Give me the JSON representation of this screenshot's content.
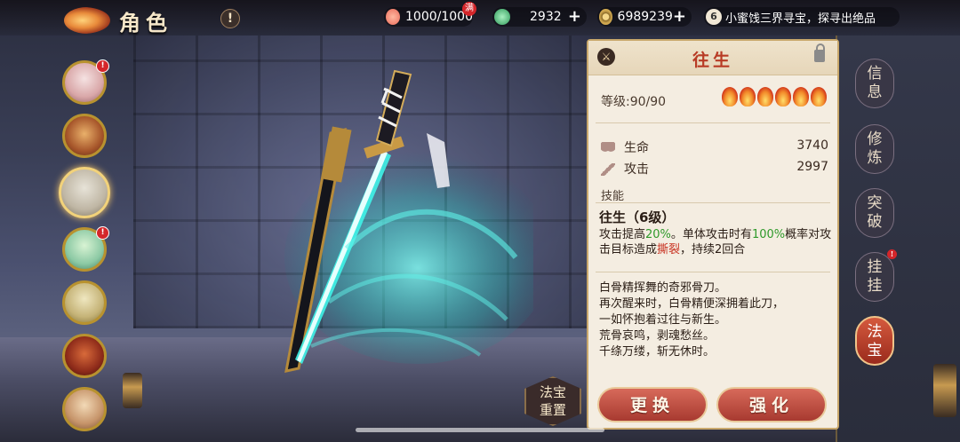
{
  "topbar": {
    "title": "角色",
    "help_label": "!",
    "stamina": "1000/1000",
    "stamina_full_badge": "满",
    "jade": "2932",
    "coins": "6989239",
    "notice_count": "6",
    "notice_text": "小蜜饯三界寻宝，探寻出绝品"
  },
  "characters": [
    {
      "alert": true
    },
    {
      "alert": false
    },
    {
      "alert": false,
      "selected": true
    },
    {
      "alert": true
    },
    {
      "alert": false
    },
    {
      "alert": false
    },
    {
      "alert": false
    }
  ],
  "reset_button": {
    "line1": "法宝",
    "line2": "重置"
  },
  "treasure": {
    "name": "往生",
    "level_label": "等级:90/90",
    "star_count": 6,
    "stats": [
      {
        "icon": "heart-icon",
        "label": "生命",
        "value": "3740"
      },
      {
        "icon": "sword-icon",
        "label": "攻击",
        "value": "2997"
      }
    ],
    "skill_header": "技能",
    "skill_name": "往生（6级）",
    "skill_desc": {
      "p1": "攻击提高",
      "v1": "20%",
      "p2": "。单体攻击时有",
      "v2": "100%",
      "p3": "概率对攻击目标造成",
      "v3": "撕裂",
      "p4": "，持续2回合"
    },
    "lore": [
      "白骨精挥舞的奇邪骨刀。",
      "再次醒来时，白骨精便深拥着此刀，",
      "一如怀抱着过往与新生。",
      "荒骨哀鸣，剥魂愁丝。",
      "千绦万缕，斩无休时。"
    ],
    "replace_label": "更换",
    "enhance_label": "强化"
  },
  "tabs": [
    {
      "label": "信息",
      "active": false,
      "alert": false
    },
    {
      "label": "修炼",
      "active": false,
      "alert": false
    },
    {
      "label": "突破",
      "active": false,
      "alert": false
    },
    {
      "label": "挂挂",
      "active": false,
      "alert": true
    },
    {
      "label": "法宝",
      "active": true,
      "alert": false
    }
  ],
  "colors": {
    "accent_red": "#b83b25",
    "skill_green": "#2f9a2b",
    "skill_red": "#c8301f"
  }
}
